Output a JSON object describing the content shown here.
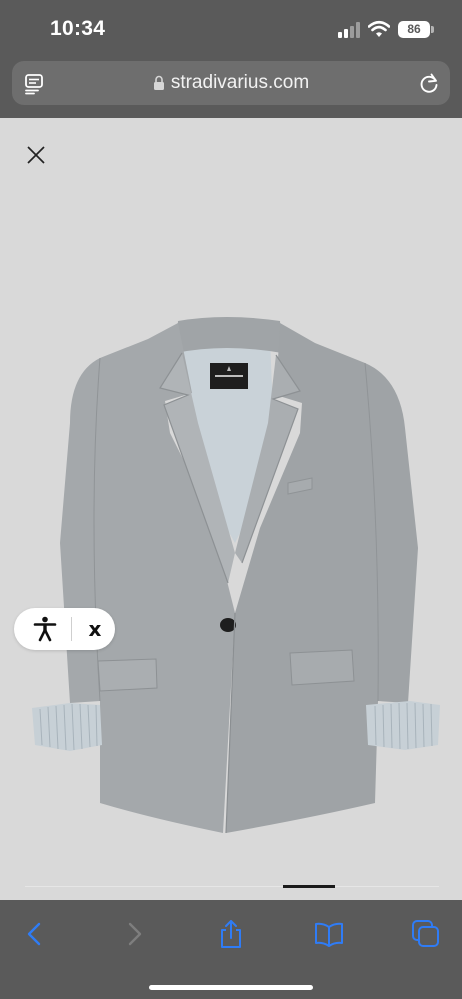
{
  "status_bar": {
    "time": "10:34",
    "battery_level": "86",
    "signal_bars_active": 2,
    "signal_bars_total": 4
  },
  "browser": {
    "url": "stradivarius.com",
    "icons": {
      "reader": "reader-mode-icon",
      "lock": "lock-icon",
      "reload": "reload-icon"
    }
  },
  "overlay": {
    "close_icon": "close-icon",
    "accessibility_icon": "accessibility-icon",
    "accessibility_close_label": "x"
  },
  "gallery": {
    "image_subject": "grey single-button blazer",
    "label_brand": "STRADIVARIUS",
    "progress_segment": "active"
  },
  "toolbar": {
    "icons": [
      "back-icon",
      "forward-icon",
      "share-icon",
      "bookmarks-icon",
      "tabs-icon"
    ]
  },
  "colors": {
    "chrome": "#5a5a5a",
    "url_bar": "#6e6e6e",
    "content_bg": "#d9d9d9",
    "blazer": "#a3a7aa",
    "lining": "#c9d2d8",
    "ios_blue": "#2f7cf6"
  }
}
